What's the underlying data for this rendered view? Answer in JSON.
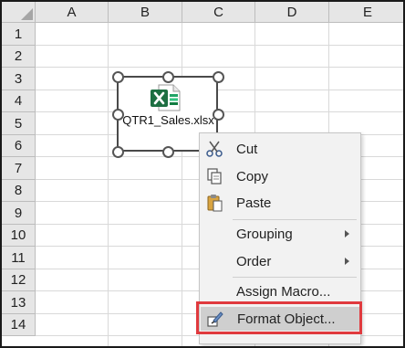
{
  "columns": [
    "A",
    "B",
    "C",
    "D",
    "E"
  ],
  "rows": [
    "1",
    "2",
    "3",
    "4",
    "5",
    "6",
    "7",
    "8",
    "9",
    "10",
    "11",
    "12",
    "13",
    "14"
  ],
  "embedded_object": {
    "icon": "excel-file-icon",
    "filename": "QTR1_Sales.xlsx"
  },
  "context_menu": {
    "items": [
      {
        "label": "Cut",
        "icon": "scissors-icon",
        "mnemonic": "t"
      },
      {
        "label": "Copy",
        "icon": "copy-icon",
        "mnemonic": "C"
      },
      {
        "label": "Paste",
        "icon": "paste-icon",
        "mnemonic": "P"
      },
      {
        "label": "Grouping",
        "submenu": true,
        "mnemonic": "G"
      },
      {
        "label": "Order",
        "submenu": true,
        "mnemonic": "O"
      },
      {
        "label": "Assign Macro...",
        "mnemonic": "N"
      },
      {
        "label": "Format Object...",
        "icon": "format-object-icon",
        "mnemonic": "F"
      }
    ]
  },
  "colors": {
    "header_bg": "#e6e6e6",
    "excel_green": "#1d6f42",
    "highlight_border": "#e03a3e"
  }
}
